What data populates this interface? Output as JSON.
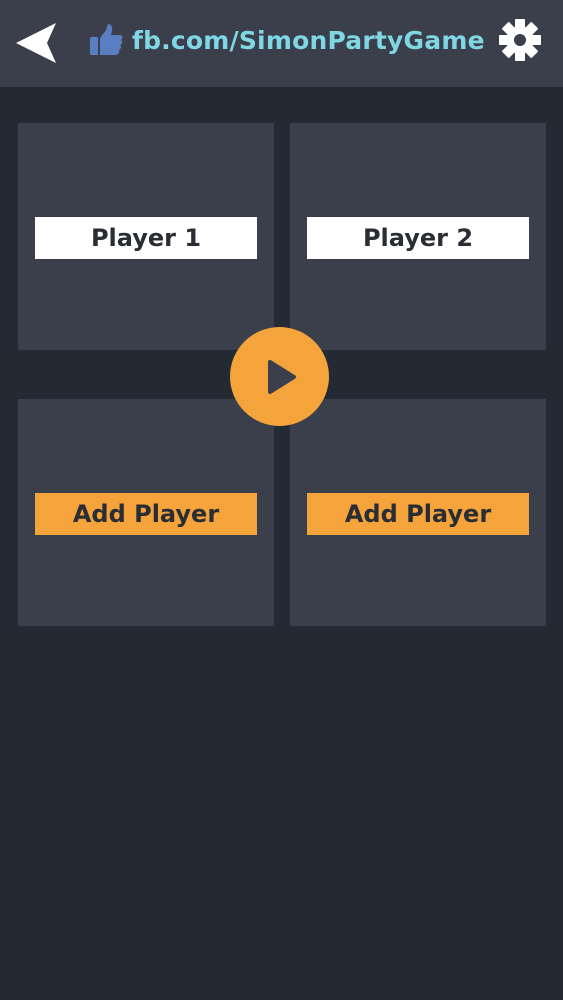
{
  "header": {
    "fb_link_text": "fb.com/SimonPartyGame",
    "icons": {
      "back": "back-arrow-icon",
      "like": "thumbs-up-icon",
      "settings": "gear-icon"
    }
  },
  "players": [
    {
      "label": "Player 1",
      "state": "named"
    },
    {
      "label": "Player 2",
      "state": "named"
    },
    {
      "label": "Add Player",
      "state": "empty"
    },
    {
      "label": "Add Player",
      "state": "empty"
    }
  ],
  "play": {
    "icon": "play-icon"
  },
  "colors": {
    "background": "#232a33",
    "panel": "#3b3f4b",
    "accent": "#f4a43a",
    "link": "#7fd7e3",
    "name_label_bg": "#ffffff",
    "label_text": "#2a2d33"
  }
}
